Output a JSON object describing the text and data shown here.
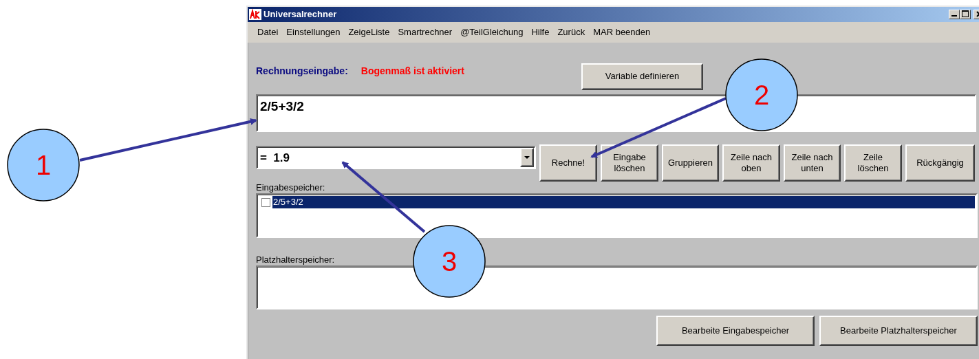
{
  "window": {
    "title": "Universalrechner"
  },
  "menu": [
    {
      "label": "Datei"
    },
    {
      "label": "Einstellungen"
    },
    {
      "label": "ZeigeListe"
    },
    {
      "label": "Smartrechner"
    },
    {
      "label": "@TeilGleichung"
    },
    {
      "label": "Hilfe"
    },
    {
      "label": "Zurück"
    },
    {
      "label": "MAR beenden"
    }
  ],
  "input_label": "Rechnungseingabe:",
  "mode_notice": "Bogenmaß ist aktiviert",
  "define_button": "Variable definieren",
  "expression": {
    "value": "2/5+3/2"
  },
  "result": {
    "value": "=  1.9"
  },
  "action_buttons": [
    "Rechne!",
    "Eingabe löschen",
    "Gruppieren",
    "Zeile nach oben",
    "Zeile nach unten",
    "Zeile löschen",
    "Rückgängig"
  ],
  "input_memory": {
    "label": "Eingabespeicher:",
    "items": [
      {
        "text": "2/5+3/2",
        "checked": false,
        "selected": true
      }
    ]
  },
  "placeholder_memory": {
    "label": "Platzhalterspeicher:"
  },
  "bottom_buttons": [
    "Bearbeite Eingabespeicher",
    "Bearbeite Platzhalterspeicher"
  ],
  "callouts": [
    {
      "label": "1"
    },
    {
      "label": "2"
    },
    {
      "label": "3"
    }
  ]
}
